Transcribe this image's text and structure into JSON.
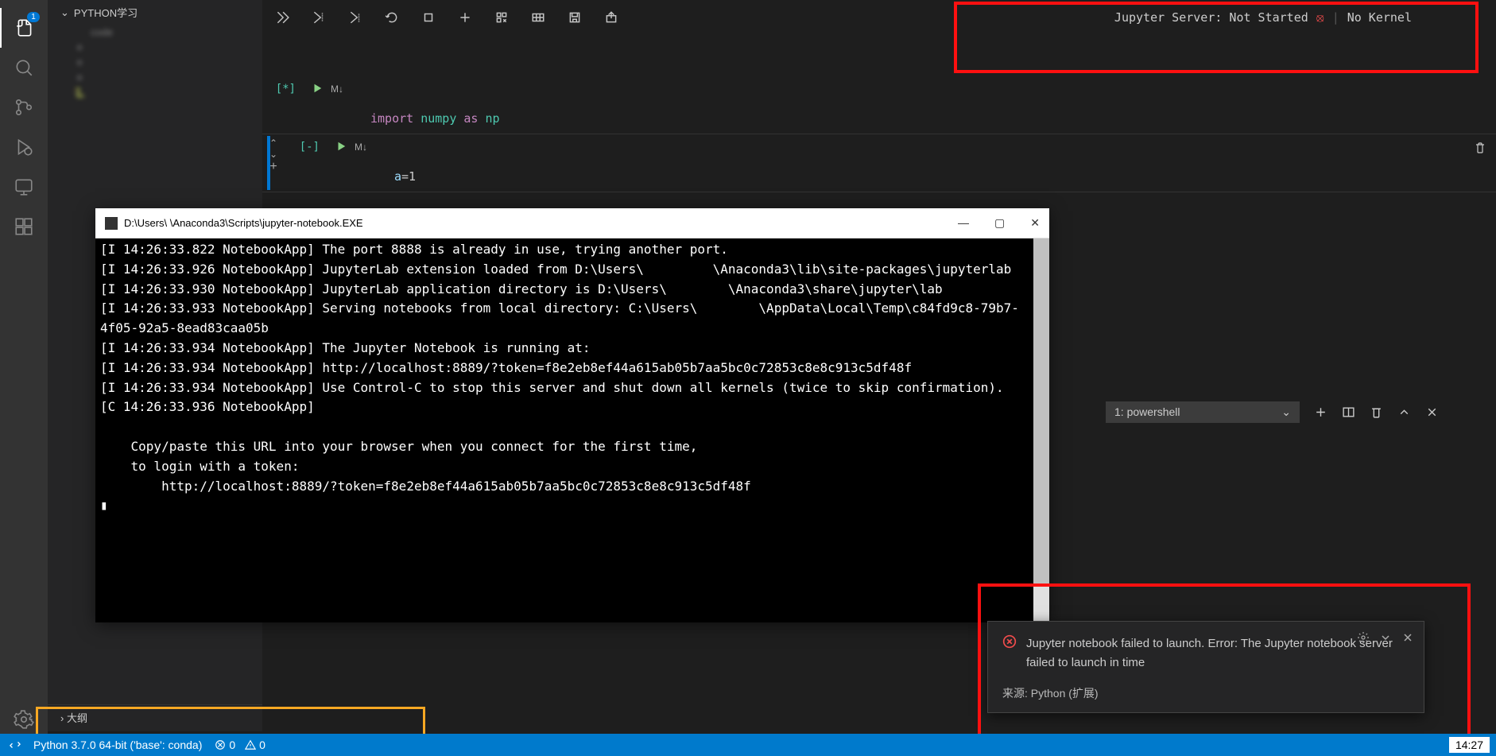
{
  "activity_badges": {
    "explorer": "1"
  },
  "sidebar": {
    "header_label": "PYTHON学习",
    "items": [
      {
        "icon": "",
        "label": "code"
      },
      {
        "icon": "≡",
        "label": ""
      },
      {
        "icon": "≡",
        "label": ""
      },
      {
        "icon": "≡",
        "label": ""
      },
      {
        "icon": "🐍",
        "label": ""
      }
    ],
    "outline_label": "大纲"
  },
  "toolbar": {},
  "jupyter": {
    "server_status": "Jupyter Server: Not Started",
    "kernel_status": "No Kernel"
  },
  "cells": [
    {
      "exec_label": "[*]",
      "md_label": "M↓",
      "code_html": "<span class='kw'>import</span> <span class='mod'>numpy</span> <span class='kw'>as</span> <span class='mod'>np</span>"
    },
    {
      "exec_label": "[-]",
      "md_label": "M↓",
      "code_html": "<span class='id'>a</span>=1"
    }
  ],
  "console": {
    "title": "D:\\Users\\        \\Anaconda3\\Scripts\\jupyter-notebook.EXE",
    "text": "[I 14:26:33.822 NotebookApp] The port 8888 is already in use, trying another port.\n[I 14:26:33.926 NotebookApp] JupyterLab extension loaded from D:\\Users\\         \\Anaconda3\\lib\\site-packages\\jupyterlab\n[I 14:26:33.930 NotebookApp] JupyterLab application directory is D:\\Users\\        \\Anaconda3\\share\\jupyter\\lab\n[I 14:26:33.933 NotebookApp] Serving notebooks from local directory: C:\\Users\\        \\AppData\\Local\\Temp\\c84fd9c8-79b7-4f05-92a5-8ead83caa05b\n[I 14:26:33.934 NotebookApp] The Jupyter Notebook is running at:\n[I 14:26:33.934 NotebookApp] http://localhost:8889/?token=f8e2eb8ef44a615ab05b7aa5bc0c72853c8e8c913c5df48f\n[I 14:26:33.934 NotebookApp] Use Control-C to stop this server and shut down all kernels (twice to skip confirmation).\n[C 14:26:33.936 NotebookApp]\n\n    Copy/paste this URL into your browser when you connect for the first time,\n    to login with a token:\n        http://localhost:8889/?token=f8e2eb8ef44a615ab05b7aa5bc0c72853c8e8c913c5df48f\n▮"
  },
  "terminal": {
    "selected": "1: powershell"
  },
  "toast": {
    "message": "Jupyter notebook failed to launch. Error: The Jupyter notebook server failed to launch in time",
    "source": "来源: Python (扩展)"
  },
  "status": {
    "python": "Python 3.7.0 64-bit ('base': conda)",
    "errors": "0",
    "warnings": "0"
  },
  "clock": "14:27"
}
